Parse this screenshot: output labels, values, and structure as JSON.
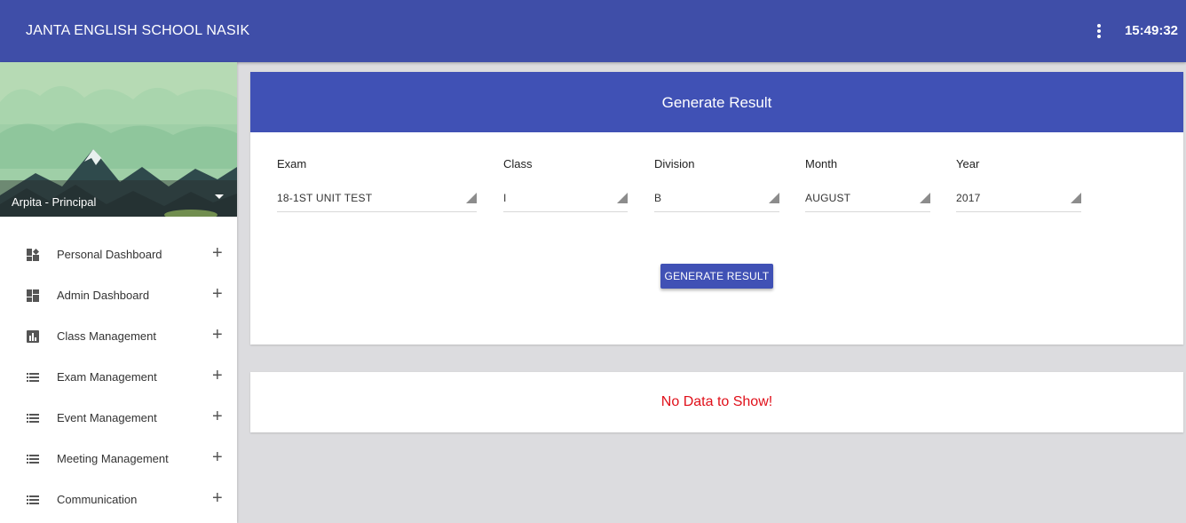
{
  "header": {
    "app_title": "JANTA ENGLISH SCHOOL NASIK",
    "menu_icon": "more-vert-icon",
    "clock": "15:49:32"
  },
  "profile": {
    "name": "Arpita - Principal",
    "caret_icon": "caret-down-icon"
  },
  "sidebar": {
    "items": [
      {
        "label": "Personal Dashboard",
        "icon": "dashboard-plus-icon"
      },
      {
        "label": "Admin Dashboard",
        "icon": "dashboard-icon"
      },
      {
        "label": "Class Management",
        "icon": "bar-chart-icon"
      },
      {
        "label": "Exam Management",
        "icon": "list-icon"
      },
      {
        "label": "Event Management",
        "icon": "list-icon"
      },
      {
        "label": "Meeting Management",
        "icon": "list-icon"
      },
      {
        "label": "Communication",
        "icon": "list-icon"
      }
    ],
    "expand_symbol": "+"
  },
  "form": {
    "title": "Generate Result",
    "fields": [
      {
        "label": "Exam",
        "value": "18-1ST UNIT TEST"
      },
      {
        "label": "Class",
        "value": "I"
      },
      {
        "label": "Division",
        "value": "B"
      },
      {
        "label": "Month",
        "value": "AUGUST"
      },
      {
        "label": "Year",
        "value": "2017"
      }
    ],
    "button_label": "GENERATE RESULT"
  },
  "results": {
    "empty_message": "No Data to Show!"
  },
  "colors": {
    "primary": "#3f4ea8",
    "card_header": "#4051b5",
    "error_text": "#e0101a",
    "background": "#dcdcdf"
  }
}
